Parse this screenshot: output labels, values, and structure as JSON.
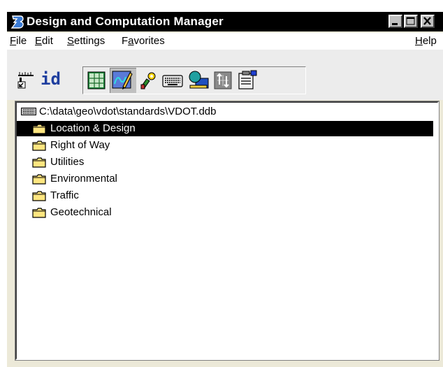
{
  "window": {
    "title": "Design and Computation Manager",
    "app_icon": "bentley-b-icon",
    "controls": [
      "minimize-icon",
      "maximize-icon",
      "close-icon"
    ]
  },
  "menu": {
    "file": {
      "u": "F",
      "rest": "ile"
    },
    "edit": {
      "u": "E",
      "rest": "dit"
    },
    "settings": {
      "u": "S",
      "rest": "ettings"
    },
    "favorites_pre": "F",
    "favorites_u": "a",
    "favorites_rest": "vorites",
    "help": {
      "u": "H",
      "rest": "elp"
    }
  },
  "toolbar": {
    "id_label": "id",
    "tools": [
      "ruler-icon",
      "id-icon",
      "grid-icon",
      "pencil-drawing-icon",
      "key-icon",
      "keyboard-icon",
      "shapes-icon",
      "updown-arrows-icon",
      "clipboard-icon"
    ],
    "active_tool": "pencil-drawing-icon"
  },
  "tree": {
    "root": "C:\\data\\geo\\vdot\\standards\\VDOT.ddb",
    "root_icon": "database-icon",
    "items": [
      {
        "label": "Location & Design",
        "icon": "folder-icon",
        "selected": true
      },
      {
        "label": "Right of Way",
        "icon": "folder-icon",
        "selected": false
      },
      {
        "label": "Utilities",
        "icon": "folder-icon",
        "selected": false
      },
      {
        "label": "Environmental",
        "icon": "folder-icon",
        "selected": false
      },
      {
        "label": "Traffic",
        "icon": "folder-icon",
        "selected": false
      },
      {
        "label": "Geotechnical",
        "icon": "folder-icon",
        "selected": false
      }
    ]
  },
  "colors": {
    "selection_bg": "#000000",
    "selection_fg": "#ffffff",
    "folder_fill": "#ffe680",
    "titlebar_bg": "#000000"
  }
}
